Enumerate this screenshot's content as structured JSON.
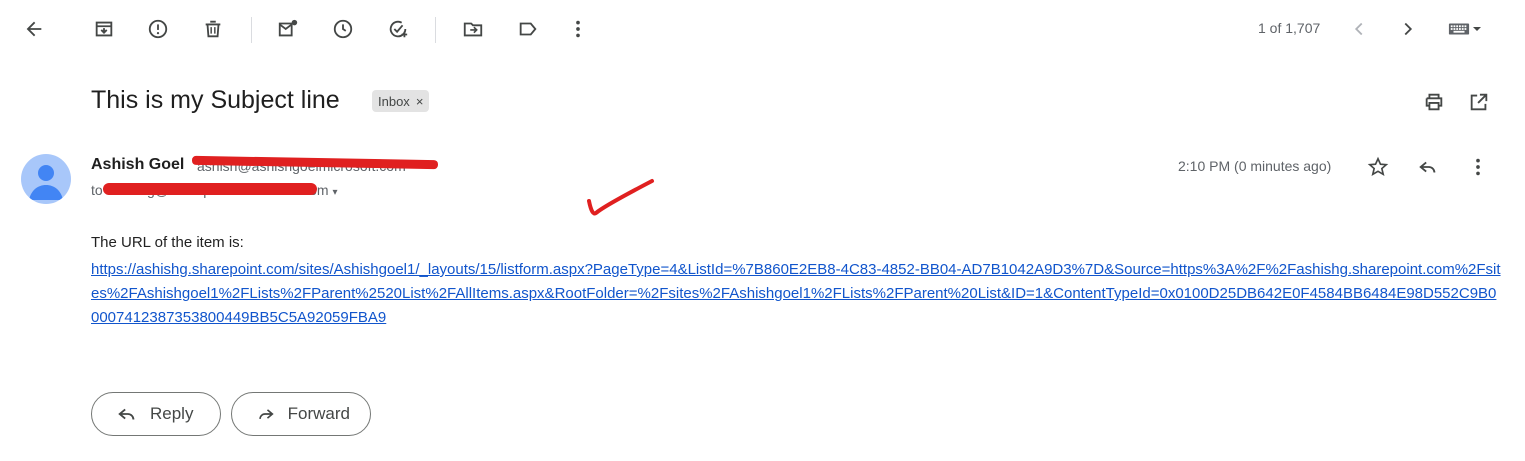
{
  "toolbar": {
    "icons": [
      "back-arrow-icon",
      "archive-icon",
      "report-spam-icon",
      "delete-icon",
      "mark-unread-icon",
      "snooze-icon",
      "add-to-tasks-icon",
      "move-to-icon",
      "label-icon",
      "more-vert-icon"
    ],
    "counter": "1 of 1,707"
  },
  "message": {
    "subject": "This is my Subject line",
    "label": "Inbox",
    "label_close": "×",
    "sender_name": "Ashish Goel",
    "sender_email": "ashish@ashishgoelmicrosoft.com",
    "to_prefix": "to",
    "recipient": "ashishg@example.onmicrosoft.com",
    "time": "2:10 PM (0 minutes ago)",
    "body_text": "The URL of the item is:",
    "url": "https://ashishg.sharepoint.com/sites/Ashishgoel1/_layouts/15/listform.aspx?PageType=4&ListId=%7B860E2EB8-4C83-4852-BB04-AD7B1042A9D3%7D&Source=https%3A%2F%2Fashishg.sharepoint.com%2Fsites%2FAshishgoel1%2FLists%2FParent%2520List%2FAllItems.aspx&RootFolder=%2Fsites%2FAshishgoel1%2FLists%2FParent%20List&ID=1&ContentTypeId=0x0100D25DB642E0F4584BB6484E98D552C9B00007412387353800449BB5C5A92059FBA9"
  },
  "actions": {
    "reply_label": "Reply",
    "forward_label": "Forward"
  },
  "colors": {
    "link": "#1155cc",
    "redaction": "#e02020",
    "avatar_bg": "#a8c7fa",
    "avatar_fg": "#4285f4"
  }
}
